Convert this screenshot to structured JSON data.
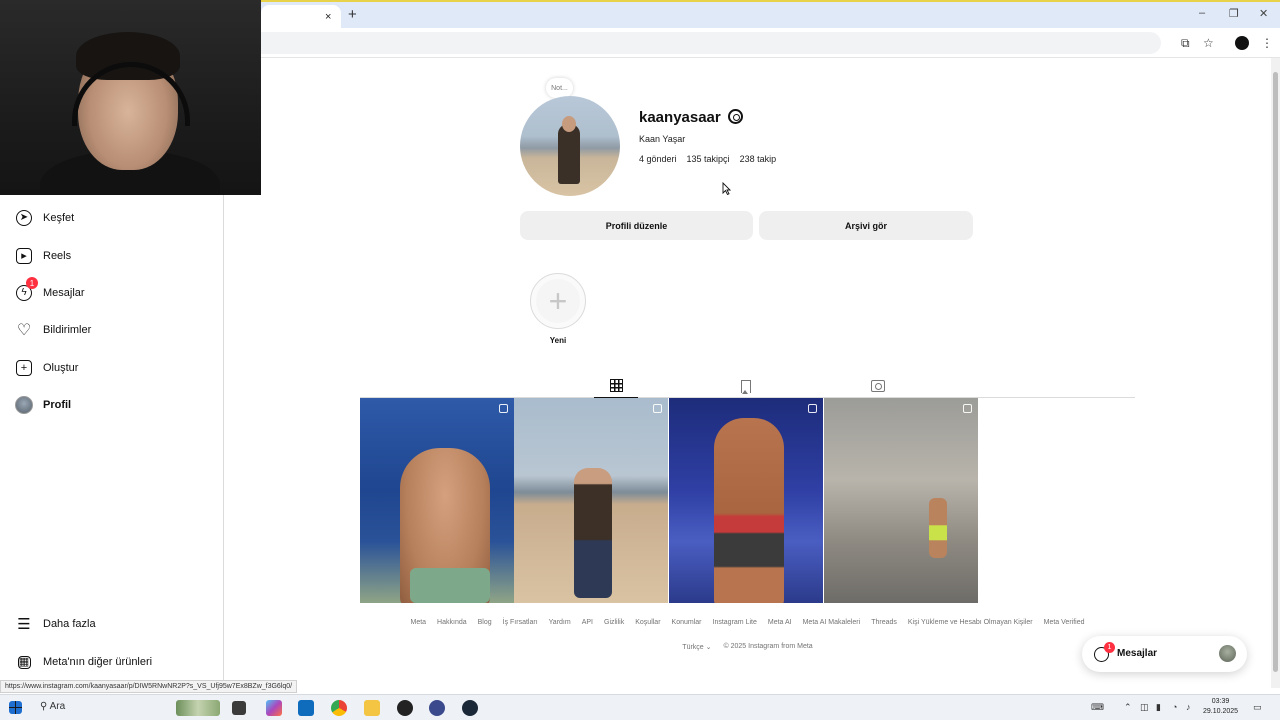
{
  "browser": {
    "tab_close": "×",
    "tab_new": "+",
    "win_min": "–",
    "win_restore": "❐",
    "win_close": "✕"
  },
  "sidebar": {
    "items": [
      {
        "label": "Keşfet",
        "icon": "compass-icon"
      },
      {
        "label": "Reels",
        "icon": "reels-icon"
      },
      {
        "label": "Mesajlar",
        "icon": "messenger-icon",
        "badge": "1"
      },
      {
        "label": "Bildirimler",
        "icon": "heart-icon"
      },
      {
        "label": "Oluştur",
        "icon": "plus-square-icon"
      },
      {
        "label": "Profil",
        "icon": "avatar"
      }
    ],
    "more_label": "Daha fazla",
    "meta_label": "Meta'nın diğer ürünleri"
  },
  "profile": {
    "note": "Not...",
    "username": "kaanyasaar",
    "fullname": "Kaan Yaşar",
    "posts": "4 gönderi",
    "followers": "135 takipçi",
    "following": "238 takip",
    "edit_button": "Profili düzenle",
    "archive_button": "Arşivi gör"
  },
  "highlight": {
    "plus": "+",
    "label": "Yeni"
  },
  "footer": {
    "links": [
      "Meta",
      "Hakkında",
      "Blog",
      "İş Fırsatları",
      "Yardım",
      "API",
      "Gizlilik",
      "Koşullar",
      "Konumlar",
      "Instagram Lite",
      "Meta AI",
      "Meta AI Makaleleri",
      "Threads",
      "Kişi Yükleme ve Hesabı Olmayan Kişiler",
      "Meta Verified"
    ],
    "language": "Türkçe ⌄",
    "copyright": "© 2025 Instagram from Meta"
  },
  "messages_float": {
    "label": "Mesajlar",
    "badge": "1"
  },
  "status_url": "https://www.instagram.com/kaanyasaar/p/DIW5RNwNR2P?s_VS_Ufj95w7Ex8BZw_f3G6lq0/",
  "taskbar": {
    "search": "Ara",
    "time": "03:39",
    "date": "29.10.2025"
  }
}
